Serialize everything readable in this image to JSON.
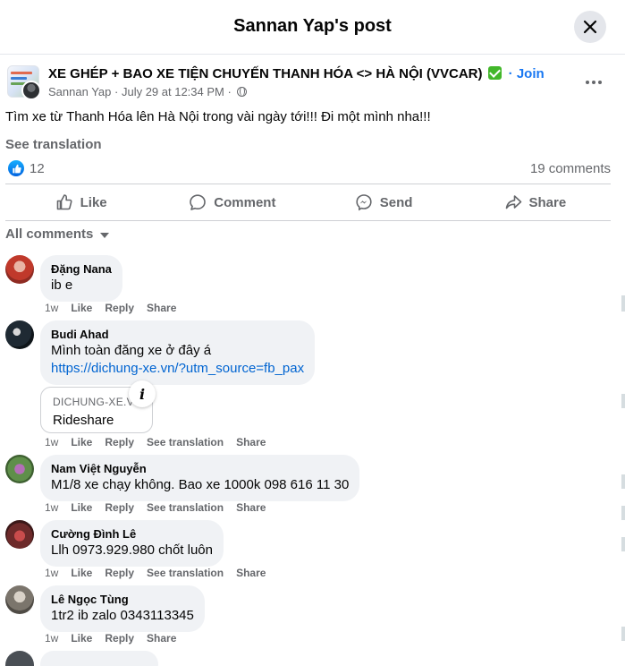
{
  "header": {
    "title": "Sannan Yap's post"
  },
  "post": {
    "group_name": "XE GHÉP + BAO XE TIỆN CHUYẾN THANH HÓA <> HÀ NỘI (VVCAR)",
    "join_label": "· Join",
    "author": "Sannan Yap",
    "timestamp": "July 29 at 12:34 PM",
    "meta_separator": "·",
    "text": "Tìm xe từ Thanh Hóa lên Hà Nội trong vài ngày tới!!! Đi một mình nha!!!",
    "see_translation": "See translation",
    "reaction_count": "12",
    "comment_count": "19 comments"
  },
  "actions": {
    "like": "Like",
    "comment": "Comment",
    "send": "Send",
    "share": "Share"
  },
  "comments_filter": "All comments",
  "comment_actions": {
    "like": "Like",
    "reply": "Reply",
    "see_translation": "See translation",
    "share": "Share"
  },
  "comments": [
    {
      "name": "Đặng Nana",
      "text": "ib e",
      "time": "1w"
    },
    {
      "name": "Budi Ahad",
      "text": "Mình toàn đăng xe ở đây á",
      "link": "https://dichung-xe.vn/?utm_source=fb_pax",
      "preview_domain": "DICHUNG-XE.V",
      "preview_title": "Rideshare",
      "time": "1w"
    },
    {
      "name": "Nam Việt Nguyễn",
      "text": "M1/8 xe chạy không. Bao xe 1000k 098 616 11 30",
      "time": "1w"
    },
    {
      "name": "Cường Đình Lê",
      "text": "Llh 0973.929.980 chốt luôn",
      "time": "1w"
    },
    {
      "name": "Lê Ngọc Tùng",
      "text": "1tr2 ib zalo 0343113345",
      "time": "1w"
    }
  ],
  "colors": {
    "accent": "#1877f2",
    "link": "#0064d1",
    "verified": "#42b72a",
    "secondary_text": "#65676b",
    "bubble": "#f0f2f5"
  }
}
